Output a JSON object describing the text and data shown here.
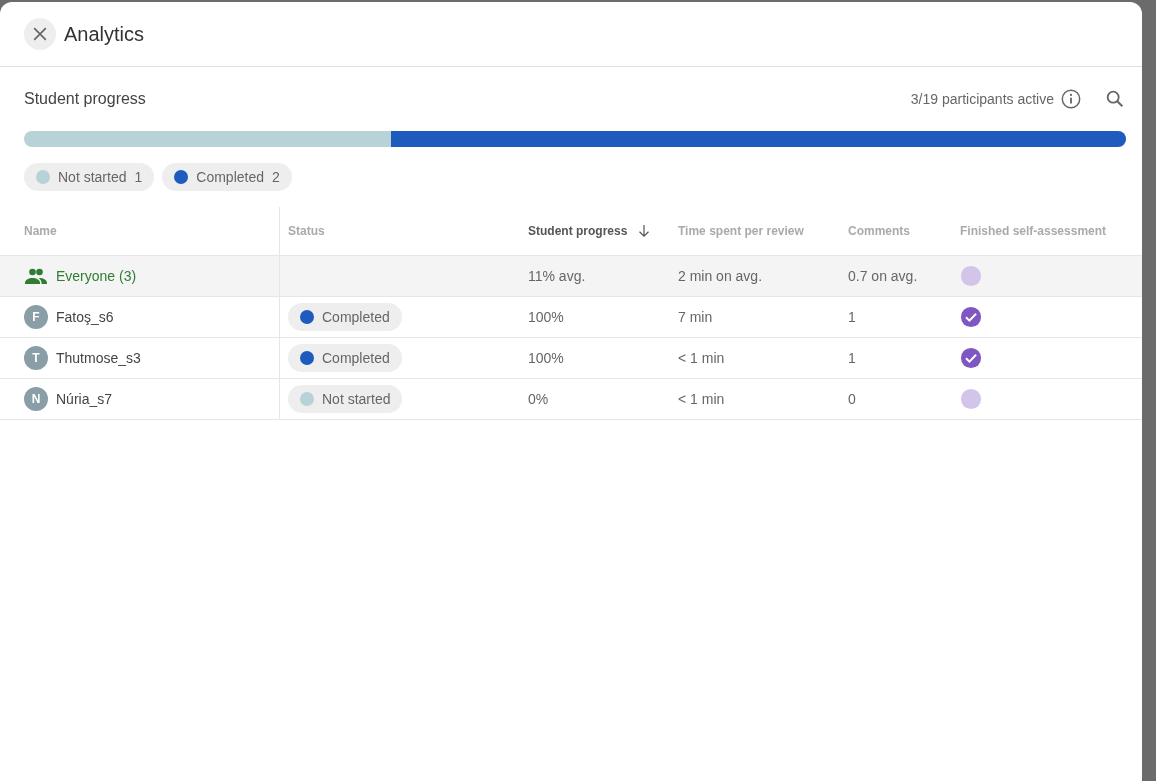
{
  "dialog": {
    "title": "Analytics"
  },
  "section": {
    "title": "Student progress",
    "participants": "3/19 participants active"
  },
  "progress_bar": {
    "level": 0.667
  },
  "legend": [
    {
      "label": "Not started",
      "count": "1",
      "color": "#b8d3d8"
    },
    {
      "label": "Completed",
      "count": "2",
      "color": "#1f5bbd"
    }
  ],
  "table": {
    "columns": [
      {
        "label": "Name",
        "sorted": false
      },
      {
        "label": "Status",
        "sorted": false
      },
      {
        "label": "Student progress",
        "sorted": true
      },
      {
        "label": "Time spent per review",
        "sorted": false
      },
      {
        "label": "Comments",
        "sorted": false
      },
      {
        "label": "Finished self-assessment",
        "sorted": false
      }
    ],
    "rows": [
      {
        "kind": "group",
        "name": "Everyone (3)",
        "progress": "11% avg.",
        "time": "2 min on avg.",
        "comments": "0.7 on avg.",
        "finished": false
      },
      {
        "kind": "student",
        "initial": "F",
        "name": "Fatoş_s6",
        "status": {
          "label": "Completed",
          "color": "#1f5bbd"
        },
        "progress": "100%",
        "time": "7 min",
        "comments": "1",
        "finished": true
      },
      {
        "kind": "student",
        "initial": "T",
        "name": "Thutmose_s3",
        "status": {
          "label": "Completed",
          "color": "#1f5bbd"
        },
        "progress": "100%",
        "time": "< 1 min",
        "comments": "1",
        "finished": true
      },
      {
        "kind": "student",
        "initial": "N",
        "name": "Núria_s7",
        "status": {
          "label": "Not started",
          "color": "#b8d3d8"
        },
        "progress": "0%",
        "time": "< 1 min",
        "comments": "0",
        "finished": false
      }
    ]
  }
}
